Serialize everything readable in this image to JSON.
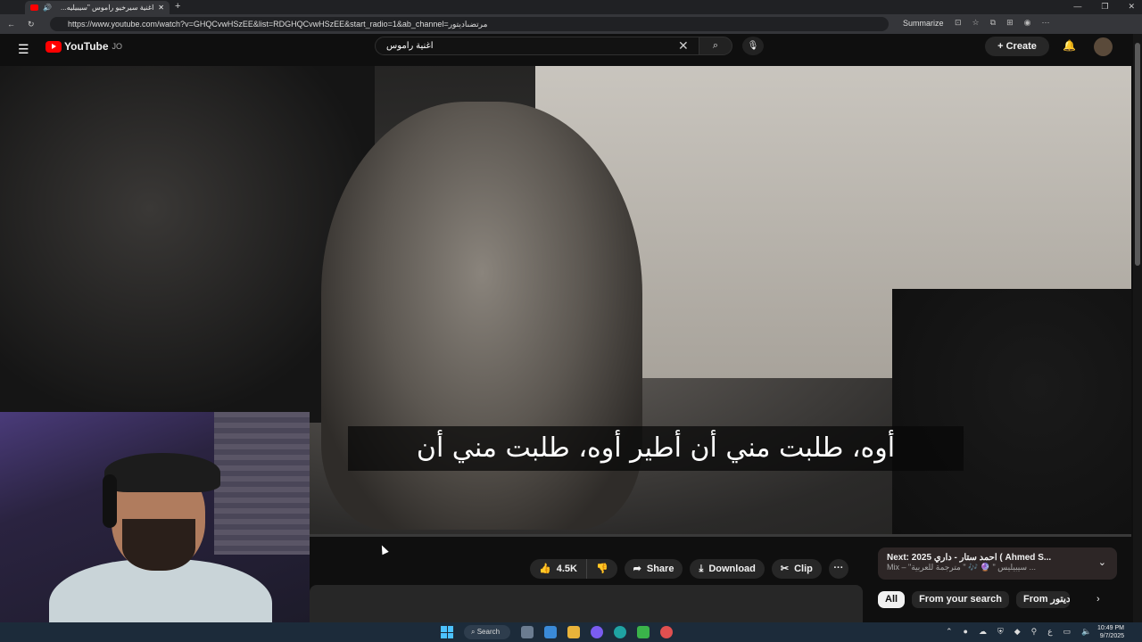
{
  "browser": {
    "tab_title": "اغنية سيرخيو راموس \"سيبيليه...",
    "url": "https://www.youtube.com/watch?v=GHQCvwHSzEE&list=RDGHQCvwHSzEE&start_radio=1&ab_channel=مرتضىاديتور",
    "summarize_label": "Summarize"
  },
  "youtube": {
    "logo_text": "YouTube",
    "country_code": "JO",
    "search_value": "اغنية راموس",
    "create_label": "Create"
  },
  "video": {
    "subtitle": "أوه، طلبت مني أن أطير أوه، طلبت مني أن"
  },
  "actions": {
    "like_count": "4.5K",
    "share_label": "Share",
    "download_label": "Download",
    "clip_label": "Clip",
    "more_label": "···"
  },
  "up_next": {
    "title": "Next: 2025 احمد ستار - داري ( Ahmed S...",
    "subtitle": "Mix – \"سيبيليس \" 🔮 🎶 \" مترجمة للعربية ..."
  },
  "chips": [
    "All",
    "From your search",
    "From مرتضى اديتور"
  ],
  "taskbar": {
    "search_label": "Search",
    "time": "10:49 PM",
    "date": "9/7/2025",
    "lang": "ع"
  },
  "icons": {
    "menu": "hamburger-icon",
    "search": "search-icon",
    "mic": "mic-icon",
    "bell": "bell-icon",
    "like": "thumb-up-icon",
    "dislike": "thumb-down-icon",
    "share": "share-icon",
    "download": "download-icon",
    "clip": "scissors-icon"
  }
}
